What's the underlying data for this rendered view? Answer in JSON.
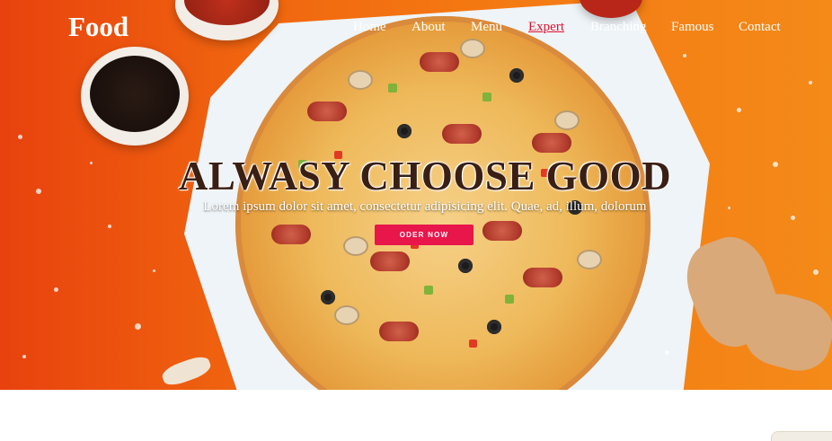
{
  "brand": {
    "logo": "Food"
  },
  "nav": {
    "items": [
      {
        "label": "Home",
        "active": false
      },
      {
        "label": "About",
        "active": false
      },
      {
        "label": "Menu",
        "active": false
      },
      {
        "label": "Expert",
        "active": true
      },
      {
        "label": "Branching",
        "active": false
      },
      {
        "label": "Famous",
        "active": false
      },
      {
        "label": "Contact",
        "active": false
      }
    ]
  },
  "hero": {
    "headline": "ALWASY CHOOSE GOOD",
    "subtitle": "Lorem ipsum dolor sit amet, consectetur adipisicing elit. Quae, ad, illum, dolorum",
    "cta_label": "ODER NOW"
  },
  "colors": {
    "accent": "#e8164b",
    "active_nav": "#e0102e",
    "hero_background": "#f47712",
    "headline": "#3a1f14"
  }
}
